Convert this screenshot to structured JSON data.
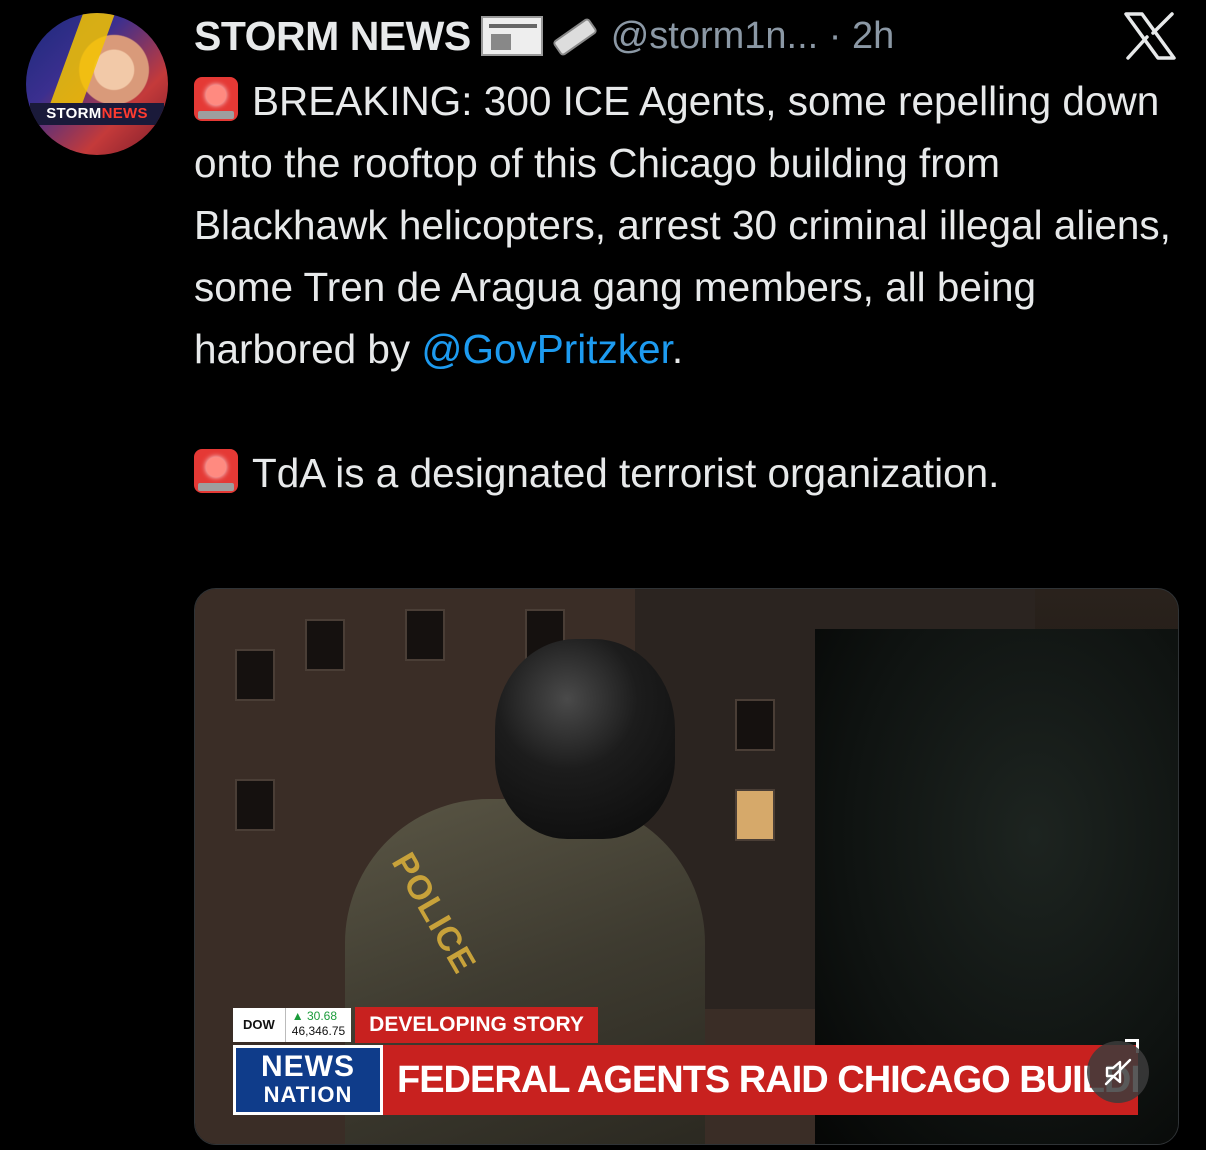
{
  "author": {
    "display_name": "STORM NEWS",
    "handle": "@storm1n...",
    "separator": "·",
    "time": "2h",
    "avatar_badge_left": "STORM",
    "avatar_badge_right": "NEWS"
  },
  "tweet": {
    "paragraph1_text": "BREAKING: 300 ICE Agents, some repelling down onto the rooftop of this Chicago building from Blackhawk helicopters, arrest 30 criminal illegal aliens, some Tren de Aragua gang members, all being harbored by ",
    "mention": "@GovPritzker",
    "paragraph1_end": ".",
    "paragraph2_text": "TdA is a designated terrorist organization."
  },
  "media": {
    "vest_text": "POLICE",
    "ticker": {
      "index_label": "DOW",
      "change": "▲ 30.68",
      "value": "46,346.75"
    },
    "tag": "DEVELOPING STORY",
    "logo_line1": "NEWS",
    "logo_line2": "NATION",
    "headline": "FEDERAL AGENTS RAID CHICAGO BUILDING"
  },
  "icons": {
    "siren": "rotating-light-icon",
    "close": "x-logo-icon",
    "mute": "speaker-muted-icon"
  },
  "colors": {
    "background": "#000000",
    "text": "#e7e9ea",
    "secondary": "#8b98a5",
    "link": "#1d9bf0",
    "news_red": "#c8211f",
    "news_blue": "#0f3c8a"
  }
}
